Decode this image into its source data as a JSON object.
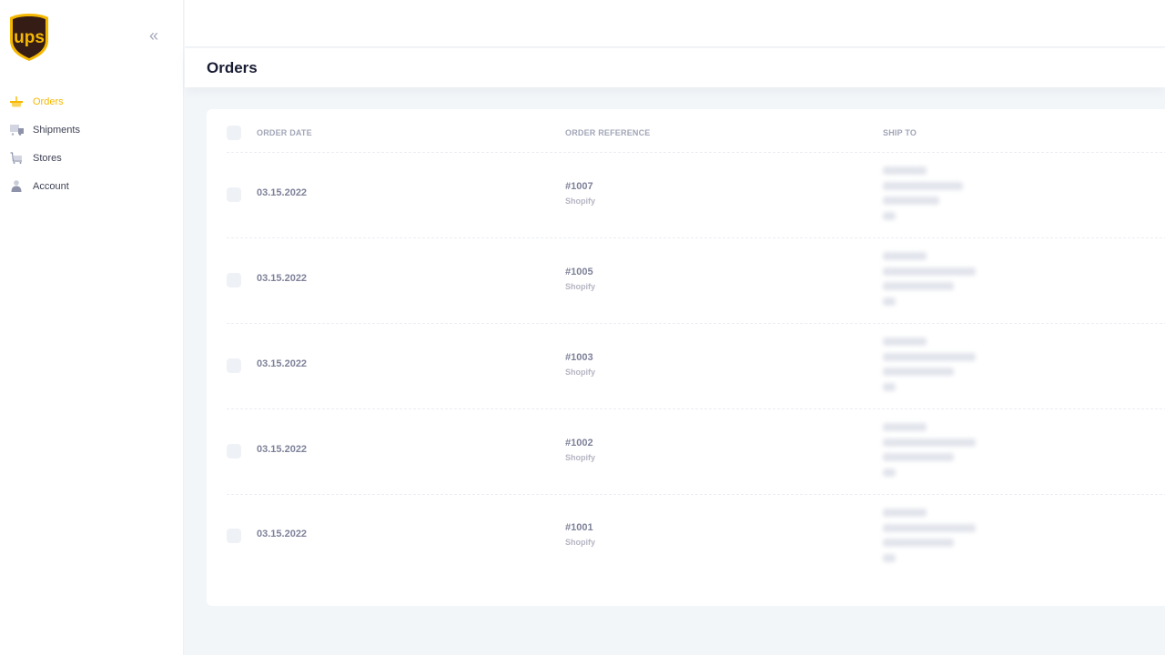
{
  "brand": {
    "name": "UPS",
    "logo_text": "ups",
    "accent_color": "#f5b800",
    "logo_brown": "#351c15"
  },
  "sidebar": {
    "collapse_icon": "double-chevron-left-icon",
    "collapse_glyph": "«",
    "items": [
      {
        "label": "Orders",
        "icon": "basket-icon",
        "active": true
      },
      {
        "label": "Shipments",
        "icon": "truck-icon",
        "active": false
      },
      {
        "label": "Stores",
        "icon": "cart-icon",
        "active": false
      },
      {
        "label": "Account",
        "icon": "user-icon",
        "active": false
      }
    ]
  },
  "page": {
    "title": "Orders"
  },
  "table": {
    "columns": [
      "ORDER DATE",
      "ORDER REFERENCE",
      "SHIP TO"
    ],
    "rows": [
      {
        "date": "03.15.2022",
        "reference": "#1007",
        "source": "Shopify",
        "ship_to": "[redacted address]"
      },
      {
        "date": "03.15.2022",
        "reference": "#1005",
        "source": "Shopify",
        "ship_to": "[redacted address]"
      },
      {
        "date": "03.15.2022",
        "reference": "#1003",
        "source": "Shopify",
        "ship_to": "[redacted address]"
      },
      {
        "date": "03.15.2022",
        "reference": "#1002",
        "source": "Shopify",
        "ship_to": "[redacted address]"
      },
      {
        "date": "03.15.2022",
        "reference": "#1001",
        "source": "Shopify",
        "ship_to": "[redacted address]"
      }
    ]
  }
}
